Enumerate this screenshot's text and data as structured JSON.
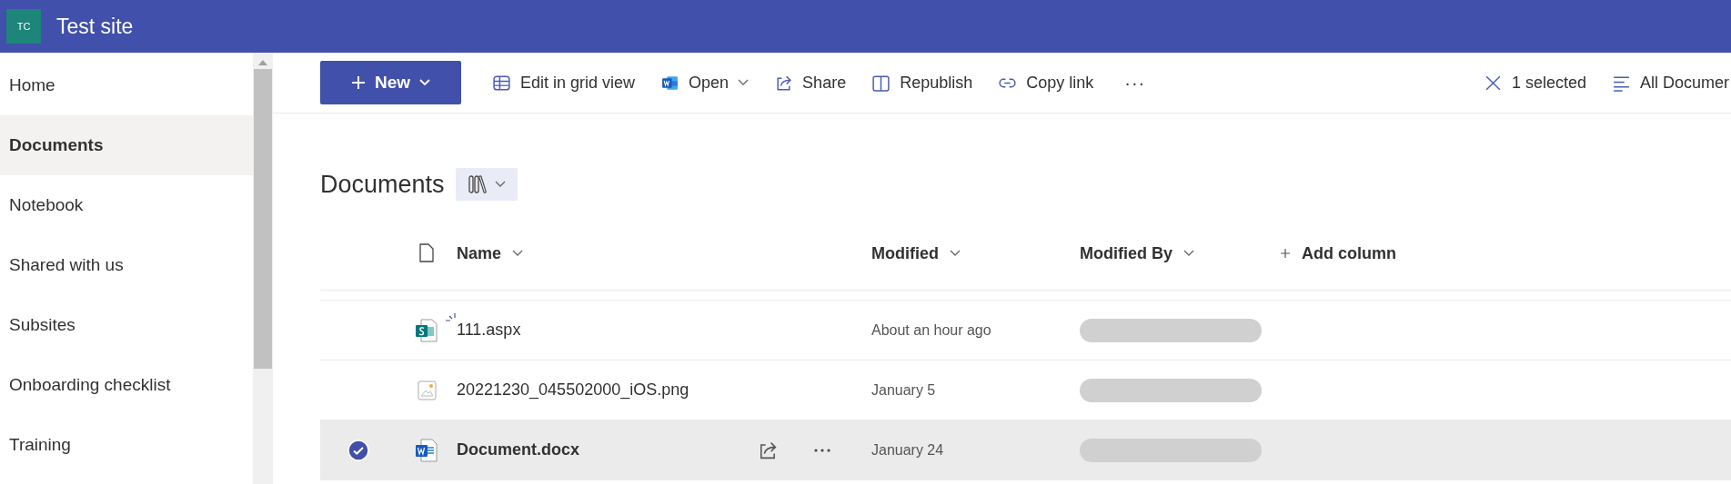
{
  "site": {
    "initials": "TC",
    "title": "Test site"
  },
  "sidebar": {
    "items": [
      {
        "label": "Home",
        "selected": false
      },
      {
        "label": "Documents",
        "selected": true
      },
      {
        "label": "Notebook",
        "selected": false
      },
      {
        "label": "Shared with us",
        "selected": false
      },
      {
        "label": "Subsites",
        "selected": false
      },
      {
        "label": "Onboarding checklist",
        "selected": false
      },
      {
        "label": "Training",
        "selected": false
      }
    ]
  },
  "toolbar": {
    "new_button": "New",
    "commands": [
      {
        "kind": "grid",
        "label": "Edit in grid view"
      },
      {
        "kind": "word",
        "label": "Open",
        "dropdown": true
      },
      {
        "kind": "share",
        "label": "Share"
      },
      {
        "kind": "republish",
        "label": "Republish"
      },
      {
        "kind": "link",
        "label": "Copy link"
      }
    ],
    "more": "···",
    "selection": "1 selected",
    "view": "All Documer"
  },
  "library": {
    "title": "Documents"
  },
  "table": {
    "columns": [
      {
        "label": "Name",
        "kind": "sort"
      },
      {
        "label": "Modified",
        "kind": "sort"
      },
      {
        "label": "Modified By",
        "kind": "sort"
      },
      {
        "label": "Add column",
        "kind": "add"
      }
    ],
    "rows": [
      {
        "kind": "sway",
        "name": "111.aspx",
        "new": true,
        "modified": "About an hour ago",
        "modified_by_redacted": true,
        "selected": false
      },
      {
        "kind": "image",
        "name": "20221230_045502000_iOS.png",
        "new": false,
        "modified": "January 5",
        "modified_by_redacted": true,
        "selected": false
      },
      {
        "kind": "word",
        "name": "Document.docx",
        "new": false,
        "modified": "January 24",
        "modified_by_redacted": true,
        "selected": true
      }
    ]
  }
}
